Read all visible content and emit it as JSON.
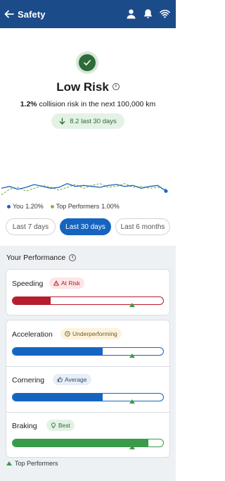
{
  "appbar": {
    "title": "Safety",
    "icons": [
      "back-arrow-icon",
      "person-icon",
      "bell-icon",
      "wifi-icon"
    ]
  },
  "hero": {
    "status_icon": "check-icon",
    "title": "Low Risk",
    "risk_pct": "1.2%",
    "risk_text": " collision risk in the next 100,000 km",
    "trend": "8.2 last 30 days",
    "trend_icon": "arrow-down-icon"
  },
  "legend": {
    "you_label": "You",
    "you_value": "1.20%",
    "top_label": "Top Performers",
    "top_value": "1.00%",
    "you_color": "#1565c0",
    "top_color": "#8bb24a"
  },
  "ranges": [
    {
      "label": "Last 7 days",
      "active": false
    },
    {
      "label": "Last 30 days",
      "active": true
    },
    {
      "label": "Last 6 months",
      "active": false
    }
  ],
  "performance": {
    "title": "Your Performance",
    "metrics": [
      {
        "label": "Speeding",
        "badge": "At Risk",
        "badge_icon": "warning-icon",
        "fill_fraction": 0.25,
        "top_performer_fraction": 0.79,
        "bar_color": "#b71c2c",
        "badge_bg": "#fde6e7",
        "badge_color": "#b71c2c"
      },
      {
        "label": "Acceleration",
        "badge": "Underperforming",
        "badge_icon": "clock-icon",
        "fill_fraction": 0.6,
        "top_performer_fraction": 0.79,
        "bar_color": "#1565c0",
        "badge_bg": "#fdf3dc",
        "badge_color": "#6b5a2e"
      },
      {
        "label": "Cornering",
        "badge": "Average",
        "badge_icon": "thumbs-up-icon",
        "fill_fraction": 0.6,
        "top_performer_fraction": 0.79,
        "bar_color": "#1565c0",
        "badge_bg": "#e6eff9",
        "badge_color": "#3c4a5c"
      },
      {
        "label": "Braking",
        "badge": "Best",
        "badge_icon": "lightbulb-icon",
        "fill_fraction": 0.9,
        "top_performer_fraction": 0.79,
        "bar_color": "#3a9a4a",
        "badge_bg": "#e3f2e5",
        "badge_color": "#2e6b36"
      }
    ],
    "footer_label": "Top Performers"
  },
  "chart_data": {
    "type": "line",
    "series": [
      {
        "name": "You",
        "values": [
          1.17,
          1.19,
          1.16,
          1.18,
          1.21,
          1.19,
          1.17,
          1.18,
          1.22,
          1.19,
          1.2,
          1.19,
          1.18,
          1.2,
          1.21,
          1.19,
          1.2,
          1.17,
          1.19,
          1.2,
          1.14
        ]
      },
      {
        "name": "Top Performers",
        "values": [
          1.1,
          1.16,
          1.18,
          1.14,
          1.17,
          1.2,
          1.18,
          1.15,
          1.18,
          1.21,
          1.17,
          1.2,
          1.22,
          1.18,
          1.19,
          1.22,
          1.18,
          1.19,
          1.17,
          1.18,
          1.16
        ]
      }
    ],
    "ylim": [
      1.0,
      1.3
    ],
    "grid": false,
    "legend": "bottom-left"
  }
}
